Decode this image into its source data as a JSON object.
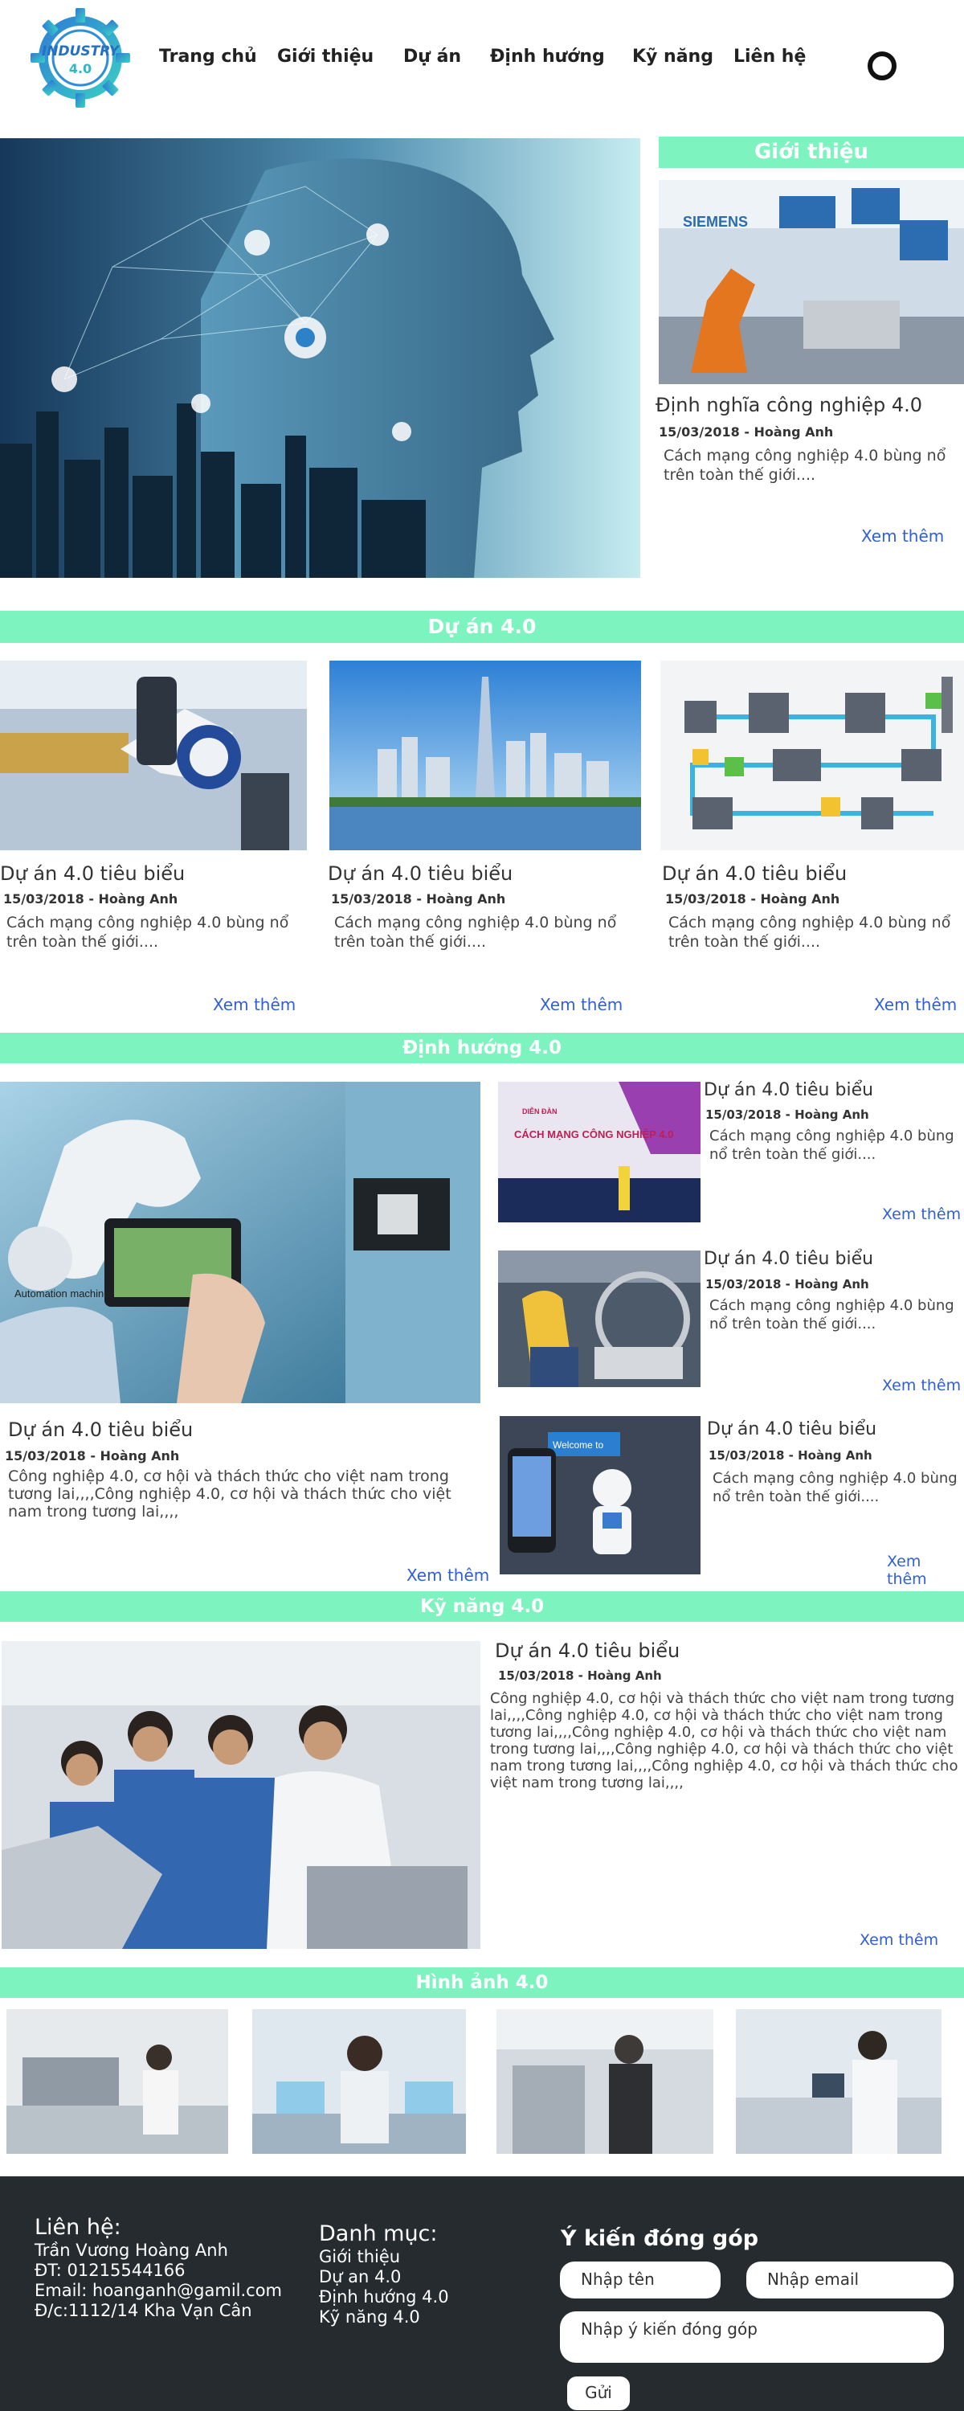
{
  "brand": {
    "logo_text": "INDUSTRY",
    "logo_sub": "4.0"
  },
  "nav": [
    "Trang chủ",
    "Giới thiệu",
    "Dự án",
    "Định hướng",
    "Kỹ năng",
    "Liên hệ"
  ],
  "intro": {
    "banner": "Giới thiệu",
    "title": "Định nghĩa công nghiệp 4.0",
    "meta": "15/03/2018 - Hoàng Anh",
    "desc": "Cách mạng công nghiệp 4.0 bùng nổ trên toàn thế giới....",
    "more": "Xem thêm",
    "photo_text": "SIEMENS"
  },
  "projects": {
    "banner": "Dự án  4.0",
    "cards": [
      {
        "title": "Dự án 4.0 tiêu biểu",
        "meta": "15/03/2018 - Hoàng Anh",
        "desc": "Cách mạng công nghiệp 4.0 bùng nổ trên toàn thế giới....",
        "more": "Xem thêm"
      },
      {
        "title": "Dự án 4.0 tiêu biểu",
        "meta": "15/03/2018 - Hoàng Anh",
        "desc": "Cách mạng công nghiệp 4.0 bùng nổ trên toàn thế giới....",
        "more": "Xem thêm"
      },
      {
        "title": "Dự án 4.0 tiêu biểu",
        "meta": "15/03/2018 - Hoàng Anh",
        "desc": "Cách mạng công nghiệp 4.0 bùng nổ trên toàn thế giới....",
        "more": "Xem thêm"
      }
    ]
  },
  "direction": {
    "banner": "Định hướng 4.0",
    "main": {
      "title": "Dự án 4.0 tiêu biểu",
      "meta": "15/03/2018 - Hoàng Anh",
      "desc": "Công nghiệp 4.0, cơ hội và thách thức cho việt nam trong tương lai,,,,Công nghiệp 4.0, cơ hội và thách thức cho việt nam trong tương lai,,,,",
      "more": "Xem thêm",
      "photo_label": "Automation machine"
    },
    "items": [
      {
        "title": "Dự án 4.0 tiêu biểu",
        "meta": "15/03/2018 - Hoàng Anh",
        "desc": "Cách mạng công nghiệp 4.0 bùng nổ trên toàn thế giới....",
        "more": "Xem thêm",
        "photo_text": "CÁCH MẠNG CÔNG NGHIỆP 4.0",
        "photo_tag": "DIỄN ĐÀN"
      },
      {
        "title": "Dự án 4.0 tiêu biểu",
        "meta": "15/03/2018 - Hoàng Anh",
        "desc": "Cách mạng công nghiệp 4.0 bùng nổ trên toàn thế giới....",
        "more": "Xem thêm"
      },
      {
        "title": "Dự án 4.0 tiêu biểu",
        "meta": "15/03/2018 - Hoàng Anh",
        "desc": "Cách mạng công nghiệp 4.0 bùng nổ trên toàn thế giới....",
        "more": "Xem thêm",
        "photo_text": "Welcome to"
      }
    ]
  },
  "skills": {
    "banner": "Kỹ năng 4.0",
    "title": "Dự án 4.0 tiêu biểu",
    "meta": "15/03/2018 - Hoàng Anh",
    "desc": "Công nghiệp 4.0, cơ hội và thách thức cho việt nam trong tương lai,,,,Công nghiệp 4.0, cơ hội và thách thức cho việt nam trong tương lai,,,,Công nghiệp 4.0, cơ hội và thách thức cho việt nam trong tương lai,,,,Công nghiệp 4.0, cơ hội và thách thức cho việt nam trong tương lai,,,,Công nghiệp 4.0, cơ hội và thách thức cho việt nam trong tương lai,,,,",
    "more": "Xem thêm"
  },
  "gallery": {
    "banner": "Hình ảnh 4.0"
  },
  "footer": {
    "contact_heading": "Liên hệ:",
    "contact_lines": [
      "Trần Vương Hoàng Anh",
      "ĐT: 01215544166",
      "Email: hoanganh@gamil.com",
      "Đ/c:1112/14 Kha Vạn Cân"
    ],
    "category_heading": "Danh mục:",
    "category_items": [
      "Giới thiệu",
      "Dự an 4.0",
      "Định hướng 4.0",
      "Kỹ năng 4.0"
    ],
    "feedback_heading": "Ý kiến đóng góp",
    "name_placeholder": "Nhập tên",
    "email_placeholder": "Nhập email",
    "message_placeholder": "Nhập ý kiến đóng góp",
    "submit_label": "Gửi"
  },
  "colors": {
    "accent": "#7df4bf",
    "footer": "#262b2f",
    "link": "#2f5fd8"
  },
  "icons": {
    "logo": "gear-logo-icon",
    "search": "search-circle-icon"
  }
}
